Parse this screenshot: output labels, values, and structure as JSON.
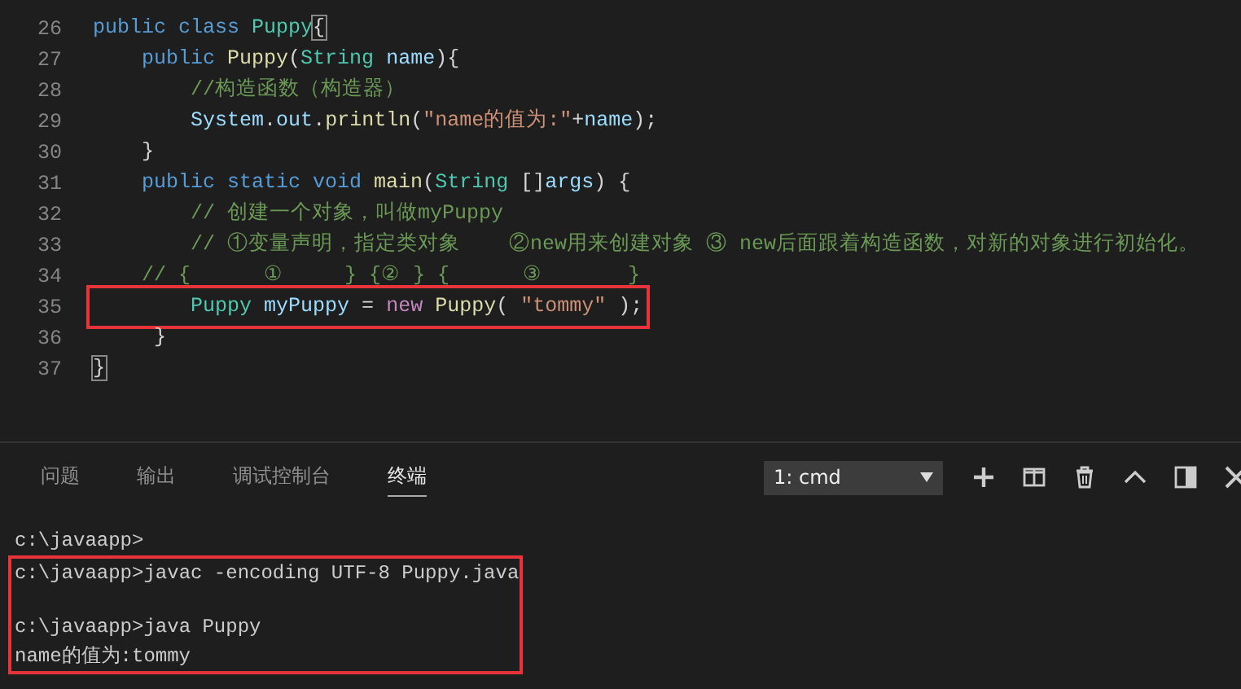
{
  "editor": {
    "lines": [
      {
        "number": "26",
        "highlighted": false,
        "tokens": [
          {
            "kind": "kw",
            "text": "public class "
          },
          {
            "kind": "type",
            "text": "Puppy"
          },
          {
            "kind": "match",
            "text": "{"
          }
        ]
      },
      {
        "number": "27",
        "highlighted": false,
        "tokens": [
          {
            "kind": "kw",
            "text": "    public "
          },
          {
            "kind": "fn",
            "text": "Puppy"
          },
          {
            "kind": "p",
            "text": "("
          },
          {
            "kind": "type",
            "text": "String "
          },
          {
            "kind": "var",
            "text": "name"
          },
          {
            "kind": "p",
            "text": "){"
          }
        ]
      },
      {
        "number": "28",
        "highlighted": false,
        "tokens": [
          {
            "kind": "cmt",
            "text": "        //构造函数（构造器）"
          }
        ]
      },
      {
        "number": "29",
        "highlighted": false,
        "tokens": [
          {
            "kind": "var",
            "text": "        System"
          },
          {
            "kind": "p",
            "text": "."
          },
          {
            "kind": "var",
            "text": "out"
          },
          {
            "kind": "p",
            "text": "."
          },
          {
            "kind": "fn",
            "text": "println"
          },
          {
            "kind": "p",
            "text": "("
          },
          {
            "kind": "str",
            "text": "\"name的值为:\""
          },
          {
            "kind": "p",
            "text": "+"
          },
          {
            "kind": "var",
            "text": "name"
          },
          {
            "kind": "p",
            "text": ");"
          }
        ]
      },
      {
        "number": "30",
        "highlighted": false,
        "tokens": [
          {
            "kind": "p",
            "text": "    }"
          }
        ]
      },
      {
        "number": "31",
        "highlighted": false,
        "tokens": [
          {
            "kind": "kw",
            "text": "    public static void "
          },
          {
            "kind": "fn",
            "text": "main"
          },
          {
            "kind": "p",
            "text": "("
          },
          {
            "kind": "type",
            "text": "String "
          },
          {
            "kind": "p",
            "text": "[]"
          },
          {
            "kind": "var",
            "text": "args"
          },
          {
            "kind": "p",
            "text": ") {"
          }
        ]
      },
      {
        "number": "32",
        "highlighted": false,
        "tokens": [
          {
            "kind": "cmt",
            "text": "        // 创建一个对象，叫做myPuppy"
          }
        ]
      },
      {
        "number": "33",
        "highlighted": false,
        "tokens": [
          {
            "kind": "cmt",
            "text": "        // ①变量声明，指定类对象    ②new用来创建对象 ③ new后面跟着构造函数，对新的对象进行初始化。"
          }
        ]
      },
      {
        "number": "34",
        "highlighted": false,
        "tokens": [
          {
            "kind": "cmt",
            "text": "    // {      ①     } {② } {      ③       }"
          }
        ]
      },
      {
        "number": "35",
        "highlighted": true,
        "tokens": [
          {
            "kind": "type",
            "text": "        Puppy "
          },
          {
            "kind": "var",
            "text": "myPuppy"
          },
          {
            "kind": "p",
            "text": " = "
          },
          {
            "kind": "new",
            "text": "new "
          },
          {
            "kind": "fn",
            "text": "Puppy"
          },
          {
            "kind": "p",
            "text": "( "
          },
          {
            "kind": "str",
            "text": "\"tommy\""
          },
          {
            "kind": "p",
            "text": " );"
          }
        ]
      },
      {
        "number": "36",
        "highlighted": false,
        "tokens": [
          {
            "kind": "p",
            "text": "     }"
          }
        ]
      },
      {
        "number": "37",
        "highlighted": false,
        "tokens": [
          {
            "kind": "match",
            "text": "}"
          }
        ]
      }
    ]
  },
  "panel": {
    "tabs": [
      {
        "label": "问题",
        "selected": false
      },
      {
        "label": "输出",
        "selected": false
      },
      {
        "label": "调试控制台",
        "selected": false
      },
      {
        "label": "终端",
        "selected": true
      }
    ],
    "terminal_select": "1: cmd",
    "terminal": [
      {
        "highlighted": false,
        "paragraphs": [
          [
            "c:\\javaapp>"
          ]
        ]
      },
      {
        "highlighted": true,
        "paragraphs": [
          [
            "c:\\javaapp>javac -encoding UTF-8 Puppy.java"
          ],
          [
            "c:\\javaapp>java Puppy",
            "name的值为:tommy"
          ]
        ]
      }
    ]
  }
}
